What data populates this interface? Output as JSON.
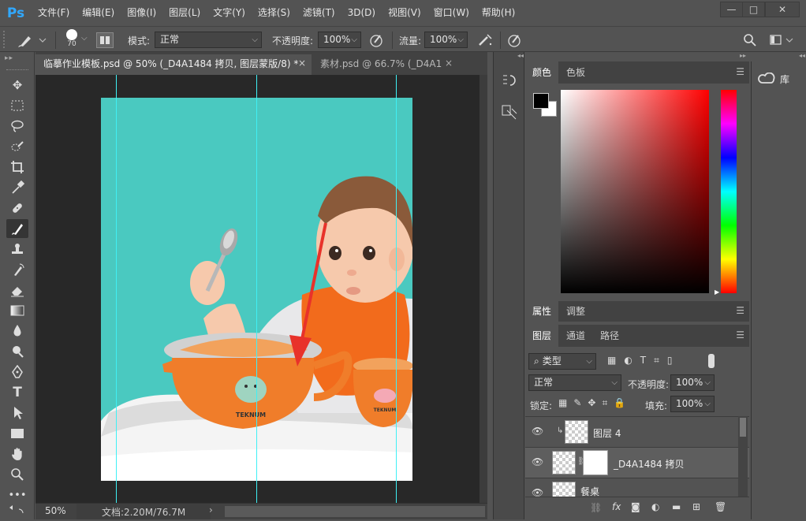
{
  "app": {
    "logo": "Ps"
  },
  "menu": [
    "文件(F)",
    "编辑(E)",
    "图像(I)",
    "图层(L)",
    "文字(Y)",
    "选择(S)",
    "滤镜(T)",
    "3D(D)",
    "视图(V)",
    "窗口(W)",
    "帮助(H)"
  ],
  "window_controls": {
    "minimize": "—",
    "restore": "□",
    "close": "✕"
  },
  "options": {
    "brush_size": "70",
    "mode_label": "模式:",
    "mode_value": "正常",
    "opacity_label": "不透明度:",
    "opacity_value": "100%",
    "flow_label": "流量:",
    "flow_value": "100%"
  },
  "tabs": [
    {
      "label": "临摹作业模板.psd @ 50% (_D4A1484 拷贝, 图层蒙版/8) *",
      "close": "×"
    },
    {
      "label": "素材.psd @ 66.7% (_D4A1",
      "close": "×"
    }
  ],
  "status": {
    "zoom": "50%",
    "doc_info": "文档:2.20M/76.7M",
    "arrow": "›"
  },
  "color_panel": {
    "tabs": [
      "颜色",
      "色板"
    ],
    "fg_color": "#000000",
    "bg_color": "#ffffff",
    "hue_color": "#ff0000"
  },
  "adjust_panel": {
    "tabs": [
      "属性",
      "调整"
    ]
  },
  "layers_panel": {
    "tabs": [
      "图层",
      "通道",
      "路径"
    ],
    "filter_label": "类型",
    "blend_mode": "正常",
    "opacity_label": "不透明度:",
    "opacity_value": "100%",
    "lock_label": "锁定:",
    "fill_label": "填充:",
    "fill_value": "100%",
    "layers": [
      {
        "name": "图层 4"
      },
      {
        "name": "_D4A1484 拷贝"
      },
      {
        "name": "餐桌"
      }
    ],
    "footer_fx": "fx"
  },
  "library_panel": {
    "label": "库"
  },
  "canvas": {
    "background_color": "#4ac9c0",
    "bowl_text": "TEKNUM",
    "cup_text": "TEKNUM"
  },
  "colors": {
    "accent": "#31a8ff",
    "guide": "#3ff0f5",
    "arrow": "#e8322a"
  }
}
